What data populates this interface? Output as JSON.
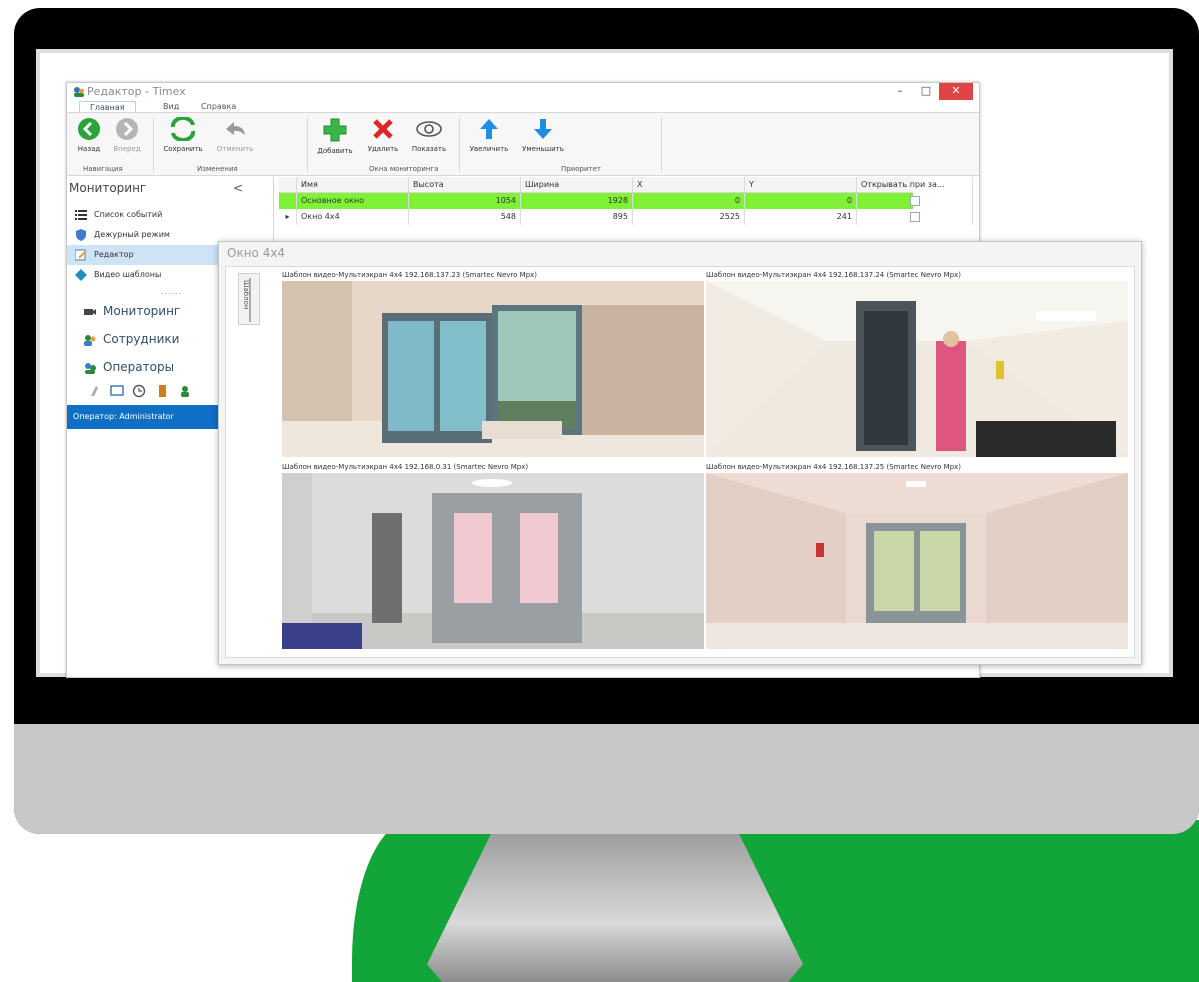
{
  "window": {
    "title": "Редактор - Timex",
    "controls": {
      "minimize": "–",
      "maximize": "□",
      "close": "✕"
    }
  },
  "menu_tabs": [
    {
      "label": "Главная",
      "active": true
    },
    {
      "label": "Вид",
      "active": false
    },
    {
      "label": "Справка",
      "active": false
    }
  ],
  "ribbon": {
    "buttons": {
      "back": "Назад",
      "forward": "Вперед",
      "save": "Сохранить",
      "cancel": "Отменить",
      "add": "Добавить",
      "delete": "Удалить",
      "show": "Показать",
      "increase": "Увеличить",
      "decrease": "Уменьшить"
    },
    "groups": {
      "navigation": "Навигация",
      "changes": "Изменения",
      "monitoring_windows": "Окна мониторинга",
      "priority": "Приоритет"
    }
  },
  "nav": {
    "header": "Мониторинг",
    "collapse": "<",
    "items": [
      "Список событий",
      "Дежурный режим",
      "Редактор",
      "Видео шаблоны"
    ],
    "grip": "......",
    "big_items": [
      "Мониторинг",
      "Сотрудники",
      "Операторы"
    ],
    "status": "Оператор: Administrator"
  },
  "grid": {
    "columns": [
      "Имя",
      "Высота",
      "Ширина",
      "X",
      "Y",
      "Открывать при за..."
    ],
    "rows": [
      {
        "marker": "",
        "name": "Основное окно",
        "height": "1054",
        "width": "1928",
        "x": "0",
        "y": "0"
      },
      {
        "marker": "▸",
        "name": "Окно 4x4",
        "height": "548",
        "width": "895",
        "x": "2525",
        "y": "241"
      }
    ]
  },
  "video_window": {
    "title": "Окно 4x4",
    "side_tab": "Шаблон",
    "cameras": [
      "Шаблон видео-Мультиэкран 4x4 192.168.137.23 (Smartec Nevro Mpx)",
      "Шаблон видео-Мультиэкран 4x4 192.168.137.24 (Smartec Nevro Mpx)",
      "Шаблон видео-Мультиэкран 4x4 192.168.0.31 (Smartec Nevro Mpx)",
      "Шаблон видео-Мультиэкран 4x4 192.168.137.25 (Smartec Nevro Mpx)"
    ]
  },
  "colors": {
    "accent_green": "#12a53a",
    "row_highlight": "#7ff238",
    "status_blue": "#0f6fc4",
    "close_red": "#e04343"
  }
}
